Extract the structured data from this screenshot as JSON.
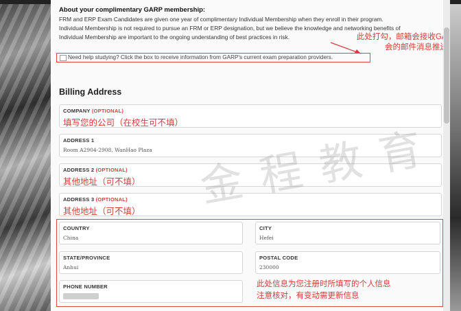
{
  "membership": {
    "title": "About your complimentary GARP membership:",
    "line1": "FRM and ERP Exam Candidates are given one year of complimentary Individual Membership when they enroll in their program.",
    "line2": "Individual Membership is not required to pursue an FRM or ERP designation, but we believe the knowledge and networking benefits of",
    "line3": "Individual Membership are important to the ongoing understanding of best practices in risk."
  },
  "annotation_top": {
    "line1": "此处打勾，邮箱会接收GARP协",
    "line2": "会的邮件消息推送"
  },
  "optin": {
    "label": "Need help studying? Click the box to receive information from GARP's current exam preparation providers.",
    "checked": false
  },
  "billing": {
    "title": "Billing Address",
    "company": {
      "label": "COMPANY",
      "optional": "(OPTIONAL)",
      "note": "填写您的公司（在校生可不填）"
    },
    "address1": {
      "label": "ADDRESS 1",
      "value": "Room A2904-2908, WanHao Plaza"
    },
    "address2": {
      "label": "ADDRESS 2",
      "optional": "(OPTIONAL)",
      "note": "其他地址（可不填）"
    },
    "address3": {
      "label": "ADDRESS 3",
      "optional": "(OPTIONAL)",
      "note": "其他地址（可不填）"
    },
    "country": {
      "label": "COUNTRY",
      "value": "China"
    },
    "city": {
      "label": "CITY",
      "value": "Hefei"
    },
    "state": {
      "label": "STATE/PROVINCE",
      "value": "Anhui"
    },
    "postal": {
      "label": "POSTAL CODE",
      "value": "230000"
    },
    "phone": {
      "label": "PHONE NUMBER"
    }
  },
  "annotation_bottom": {
    "line1": "此处信息为您注册时所填写的个人信息",
    "line2": "注意核对，有变动需更新信息"
  },
  "watermark": "金程教育",
  "colors": {
    "annotation_red": "#d63c3c",
    "optional_red": "#d94040",
    "panel_bg": "#fafafa"
  }
}
